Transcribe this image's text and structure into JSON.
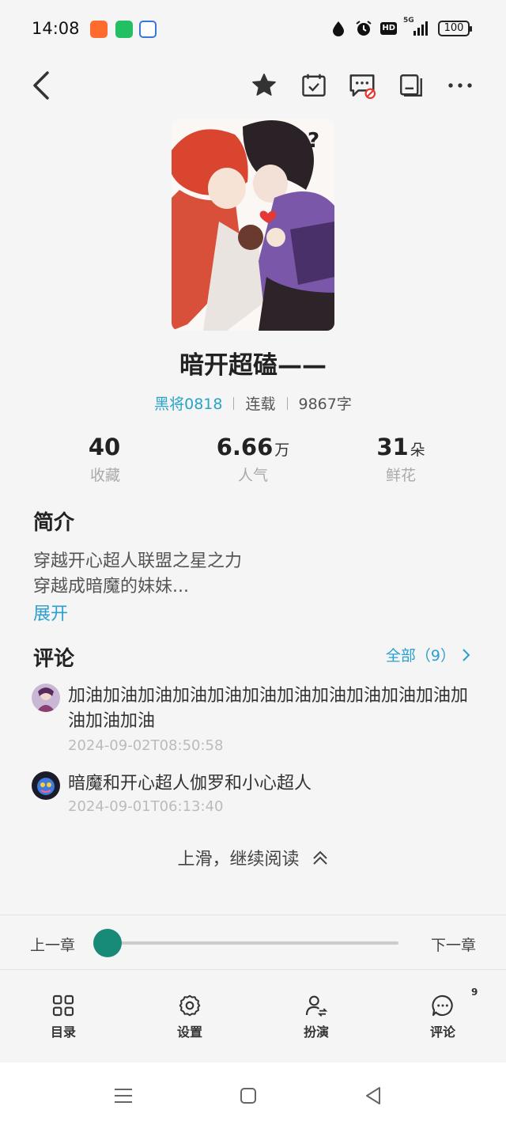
{
  "status_bar": {
    "time": "14:08",
    "network": "5G",
    "hd_label": "HD",
    "battery": "100"
  },
  "nav": {
    "icons": [
      "back-icon",
      "star-icon",
      "calendar-check-icon",
      "comment-off-icon",
      "shelf-icon",
      "more-icon"
    ]
  },
  "book": {
    "title": "暗开超磕——",
    "author": "黑将0818",
    "status": "连载",
    "word_count": "9867字"
  },
  "stats": [
    {
      "value": "40",
      "unit": "",
      "label": "收藏"
    },
    {
      "value": "6.66",
      "unit": "万",
      "label": "人气"
    },
    {
      "value": "31",
      "unit": "朵",
      "label": "鲜花"
    }
  ],
  "intro": {
    "heading": "简介",
    "lines": [
      "穿越开心超人联盟之星之力",
      "穿越成暗魔的妹妹..."
    ],
    "expand": "展开"
  },
  "comments": {
    "heading": "评论",
    "all_link": "全部（9）",
    "items": [
      {
        "text": "加油加油加油加油加油加油加油加油加油加油加油加油加油加油",
        "time": "2024-09-02T08:50:58"
      },
      {
        "text": "暗魔和开心超人伽罗和小心超人",
        "time": "2024-09-01T06:13:40"
      }
    ]
  },
  "continue_reading": "上滑，继续阅读",
  "chapter_nav": {
    "prev": "上一章",
    "next": "下一章",
    "progress": 0
  },
  "tabs": [
    {
      "label": "目录",
      "icon": "grid-icon"
    },
    {
      "label": "设置",
      "icon": "gear-icon"
    },
    {
      "label": "扮演",
      "icon": "person-swap-icon"
    },
    {
      "label": "评论",
      "icon": "chat-icon"
    }
  ],
  "comment_badge": "9",
  "colors": {
    "accent": "#2aa3c9",
    "slider": "#178b78",
    "background": "#f5f5f5"
  }
}
